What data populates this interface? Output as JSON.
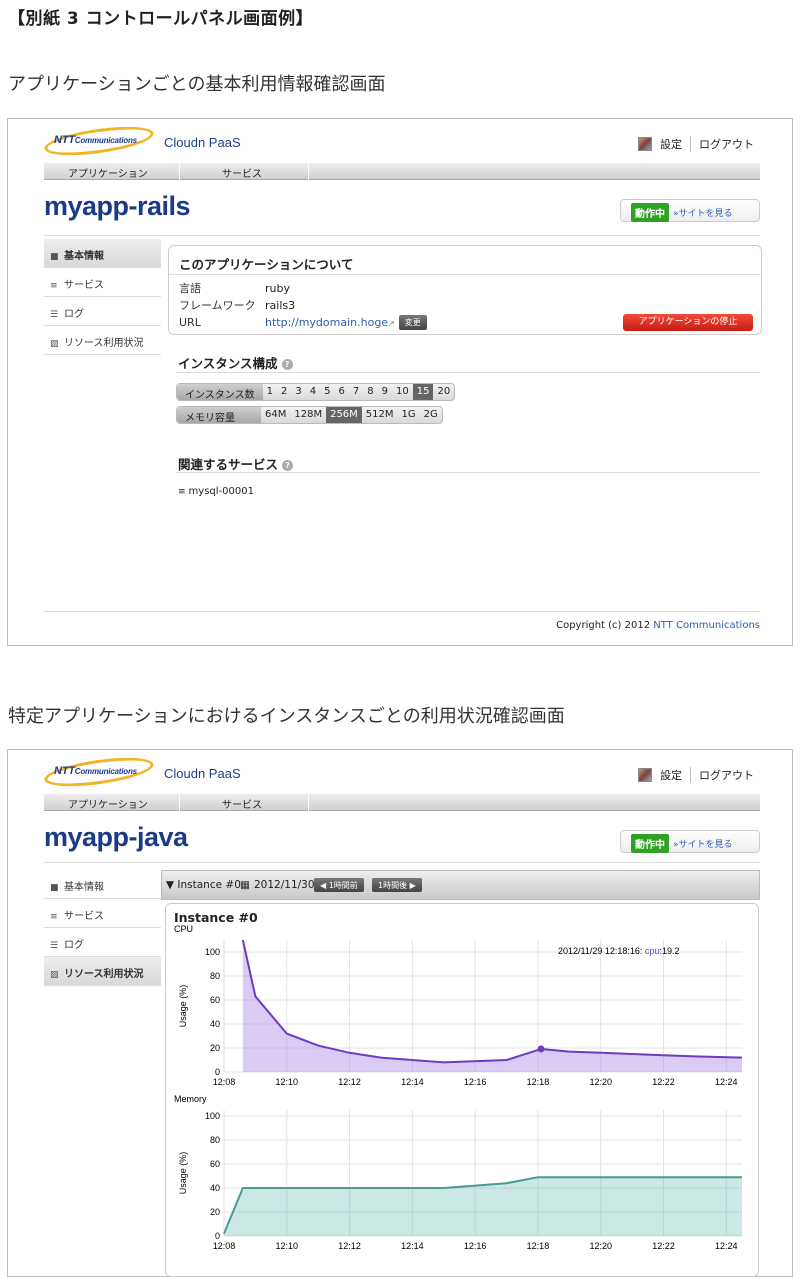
{
  "doc_title": "【別紙 3  コントロールパネル画面例】",
  "caption1": "アプリケーションごとの基本利用情報確認画面",
  "caption2": "特定アプリケーションにおけるインスタンスごとの利用状況確認画面",
  "header": {
    "logo_text": "NTT",
    "logo_sub": "Communications",
    "brand": "Cloudn PaaS",
    "settings": "設定",
    "logout": "ログアウト"
  },
  "nav": {
    "apps": "アプリケーション",
    "services": "サービス"
  },
  "status": {
    "badge": "動作中",
    "site_link": "»サイトを見る"
  },
  "sidebar": {
    "items": [
      {
        "label": "基本情報",
        "icon": "cube-icon"
      },
      {
        "label": "サービス",
        "icon": "database-icon"
      },
      {
        "label": "ログ",
        "icon": "list-icon"
      },
      {
        "label": "リソース利用状況",
        "icon": "chart-icon"
      }
    ]
  },
  "screen1": {
    "app_name": "myapp-rails",
    "about": {
      "title": "このアプリケーションについて",
      "lang_key": "言語",
      "lang_val": "ruby",
      "fw_key": "フレームワーク",
      "fw_val": "rails3",
      "url_key": "URL",
      "url_val": "http://mydomain.hoge",
      "change": "変更",
      "stop": "アプリケーションの停止"
    },
    "instance_title": "インスタンス構成",
    "instances": {
      "label": "インスタンス数",
      "options": [
        "1",
        "2",
        "3",
        "4",
        "5",
        "6",
        "7",
        "8",
        "9",
        "10",
        "15",
        "20"
      ],
      "selected": "15"
    },
    "memory": {
      "label": "メモリ容量",
      "options": [
        "64M",
        "128M",
        "256M",
        "512M",
        "1G",
        "2G"
      ],
      "selected": "256M"
    },
    "services_title": "関連するサービス",
    "service_item": "mysql-00001",
    "copyright_prefix": "Copyright (c) 2012 ",
    "copyright_link": "NTT Communications"
  },
  "screen2": {
    "app_name": "myapp-java",
    "toolbar": {
      "instance": "▼ Instance #0",
      "date": "2012/11/30",
      "prev": "◀ 1時間前",
      "next": "1時間後 ▶"
    },
    "panel_title": "Instance #0"
  },
  "chart_data": [
    {
      "type": "area",
      "title": "CPU",
      "ylabel": "Usage (%)",
      "ylim": [
        0,
        110
      ],
      "x_ticks": [
        "12:08",
        "12:10",
        "12:12",
        "12:14",
        "12:16",
        "12:18",
        "12:20",
        "12:22",
        "12:24"
      ],
      "x": [
        "12:08",
        "12:08:40",
        "12:09:20",
        "12:10:20",
        "12:11",
        "12:12",
        "12:13",
        "12:14",
        "12:15",
        "12:16",
        "12:17",
        "12:18:16",
        "12:19",
        "12:20",
        "12:21",
        "12:22",
        "12:23",
        "12:24"
      ],
      "y_ticks": [
        0,
        20,
        40,
        60,
        80,
        100
      ],
      "series": [
        {
          "name": "cpu",
          "values": [
            null,
            110,
            63,
            32,
            22,
            16,
            12,
            10,
            8,
            9,
            10,
            19.2,
            17,
            16,
            15,
            14,
            13,
            12
          ],
          "color": "#6f3bbf"
        }
      ],
      "tooltip": {
        "time": "2012/11/29 12:18:16: ",
        "key": "cpu",
        "value": ":19.2"
      },
      "grid": true
    },
    {
      "type": "area",
      "title": "Memory",
      "ylabel": "Usage (%)",
      "ylim": [
        0,
        105
      ],
      "x_ticks": [
        "12:08",
        "12:10",
        "12:12",
        "12:14",
        "12:16",
        "12:18",
        "12:20",
        "12:22",
        "12:24"
      ],
      "y_ticks": [
        0,
        20,
        40,
        60,
        80,
        100
      ],
      "series": [
        {
          "name": "memory",
          "color": "#4a9a94",
          "points": [
            [
              0,
              2
            ],
            [
              0.6,
              40
            ],
            [
              4,
              40
            ],
            [
              7,
              40
            ],
            [
              9,
              44
            ],
            [
              10,
              49
            ],
            [
              16.5,
              49
            ]
          ]
        }
      ],
      "grid": true
    }
  ]
}
